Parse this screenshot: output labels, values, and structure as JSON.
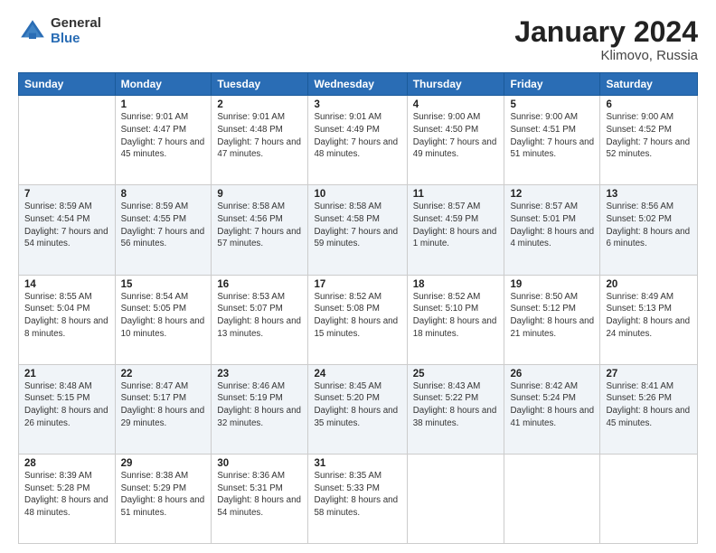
{
  "logo": {
    "general": "General",
    "blue": "Blue"
  },
  "header": {
    "month": "January 2024",
    "location": "Klimovo, Russia"
  },
  "days_of_week": [
    "Sunday",
    "Monday",
    "Tuesday",
    "Wednesday",
    "Thursday",
    "Friday",
    "Saturday"
  ],
  "weeks": [
    [
      {
        "day": "",
        "sunrise": "",
        "sunset": "",
        "daylight": ""
      },
      {
        "day": "1",
        "sunrise": "Sunrise: 9:01 AM",
        "sunset": "Sunset: 4:47 PM",
        "daylight": "Daylight: 7 hours and 45 minutes."
      },
      {
        "day": "2",
        "sunrise": "Sunrise: 9:01 AM",
        "sunset": "Sunset: 4:48 PM",
        "daylight": "Daylight: 7 hours and 47 minutes."
      },
      {
        "day": "3",
        "sunrise": "Sunrise: 9:01 AM",
        "sunset": "Sunset: 4:49 PM",
        "daylight": "Daylight: 7 hours and 48 minutes."
      },
      {
        "day": "4",
        "sunrise": "Sunrise: 9:00 AM",
        "sunset": "Sunset: 4:50 PM",
        "daylight": "Daylight: 7 hours and 49 minutes."
      },
      {
        "day": "5",
        "sunrise": "Sunrise: 9:00 AM",
        "sunset": "Sunset: 4:51 PM",
        "daylight": "Daylight: 7 hours and 51 minutes."
      },
      {
        "day": "6",
        "sunrise": "Sunrise: 9:00 AM",
        "sunset": "Sunset: 4:52 PM",
        "daylight": "Daylight: 7 hours and 52 minutes."
      }
    ],
    [
      {
        "day": "7",
        "sunrise": "Sunrise: 8:59 AM",
        "sunset": "Sunset: 4:54 PM",
        "daylight": "Daylight: 7 hours and 54 minutes."
      },
      {
        "day": "8",
        "sunrise": "Sunrise: 8:59 AM",
        "sunset": "Sunset: 4:55 PM",
        "daylight": "Daylight: 7 hours and 56 minutes."
      },
      {
        "day": "9",
        "sunrise": "Sunrise: 8:58 AM",
        "sunset": "Sunset: 4:56 PM",
        "daylight": "Daylight: 7 hours and 57 minutes."
      },
      {
        "day": "10",
        "sunrise": "Sunrise: 8:58 AM",
        "sunset": "Sunset: 4:58 PM",
        "daylight": "Daylight: 7 hours and 59 minutes."
      },
      {
        "day": "11",
        "sunrise": "Sunrise: 8:57 AM",
        "sunset": "Sunset: 4:59 PM",
        "daylight": "Daylight: 8 hours and 1 minute."
      },
      {
        "day": "12",
        "sunrise": "Sunrise: 8:57 AM",
        "sunset": "Sunset: 5:01 PM",
        "daylight": "Daylight: 8 hours and 4 minutes."
      },
      {
        "day": "13",
        "sunrise": "Sunrise: 8:56 AM",
        "sunset": "Sunset: 5:02 PM",
        "daylight": "Daylight: 8 hours and 6 minutes."
      }
    ],
    [
      {
        "day": "14",
        "sunrise": "Sunrise: 8:55 AM",
        "sunset": "Sunset: 5:04 PM",
        "daylight": "Daylight: 8 hours and 8 minutes."
      },
      {
        "day": "15",
        "sunrise": "Sunrise: 8:54 AM",
        "sunset": "Sunset: 5:05 PM",
        "daylight": "Daylight: 8 hours and 10 minutes."
      },
      {
        "day": "16",
        "sunrise": "Sunrise: 8:53 AM",
        "sunset": "Sunset: 5:07 PM",
        "daylight": "Daylight: 8 hours and 13 minutes."
      },
      {
        "day": "17",
        "sunrise": "Sunrise: 8:52 AM",
        "sunset": "Sunset: 5:08 PM",
        "daylight": "Daylight: 8 hours and 15 minutes."
      },
      {
        "day": "18",
        "sunrise": "Sunrise: 8:52 AM",
        "sunset": "Sunset: 5:10 PM",
        "daylight": "Daylight: 8 hours and 18 minutes."
      },
      {
        "day": "19",
        "sunrise": "Sunrise: 8:50 AM",
        "sunset": "Sunset: 5:12 PM",
        "daylight": "Daylight: 8 hours and 21 minutes."
      },
      {
        "day": "20",
        "sunrise": "Sunrise: 8:49 AM",
        "sunset": "Sunset: 5:13 PM",
        "daylight": "Daylight: 8 hours and 24 minutes."
      }
    ],
    [
      {
        "day": "21",
        "sunrise": "Sunrise: 8:48 AM",
        "sunset": "Sunset: 5:15 PM",
        "daylight": "Daylight: 8 hours and 26 minutes."
      },
      {
        "day": "22",
        "sunrise": "Sunrise: 8:47 AM",
        "sunset": "Sunset: 5:17 PM",
        "daylight": "Daylight: 8 hours and 29 minutes."
      },
      {
        "day": "23",
        "sunrise": "Sunrise: 8:46 AM",
        "sunset": "Sunset: 5:19 PM",
        "daylight": "Daylight: 8 hours and 32 minutes."
      },
      {
        "day": "24",
        "sunrise": "Sunrise: 8:45 AM",
        "sunset": "Sunset: 5:20 PM",
        "daylight": "Daylight: 8 hours and 35 minutes."
      },
      {
        "day": "25",
        "sunrise": "Sunrise: 8:43 AM",
        "sunset": "Sunset: 5:22 PM",
        "daylight": "Daylight: 8 hours and 38 minutes."
      },
      {
        "day": "26",
        "sunrise": "Sunrise: 8:42 AM",
        "sunset": "Sunset: 5:24 PM",
        "daylight": "Daylight: 8 hours and 41 minutes."
      },
      {
        "day": "27",
        "sunrise": "Sunrise: 8:41 AM",
        "sunset": "Sunset: 5:26 PM",
        "daylight": "Daylight: 8 hours and 45 minutes."
      }
    ],
    [
      {
        "day": "28",
        "sunrise": "Sunrise: 8:39 AM",
        "sunset": "Sunset: 5:28 PM",
        "daylight": "Daylight: 8 hours and 48 minutes."
      },
      {
        "day": "29",
        "sunrise": "Sunrise: 8:38 AM",
        "sunset": "Sunset: 5:29 PM",
        "daylight": "Daylight: 8 hours and 51 minutes."
      },
      {
        "day": "30",
        "sunrise": "Sunrise: 8:36 AM",
        "sunset": "Sunset: 5:31 PM",
        "daylight": "Daylight: 8 hours and 54 minutes."
      },
      {
        "day": "31",
        "sunrise": "Sunrise: 8:35 AM",
        "sunset": "Sunset: 5:33 PM",
        "daylight": "Daylight: 8 hours and 58 minutes."
      },
      {
        "day": "",
        "sunrise": "",
        "sunset": "",
        "daylight": ""
      },
      {
        "day": "",
        "sunrise": "",
        "sunset": "",
        "daylight": ""
      },
      {
        "day": "",
        "sunrise": "",
        "sunset": "",
        "daylight": ""
      }
    ]
  ]
}
